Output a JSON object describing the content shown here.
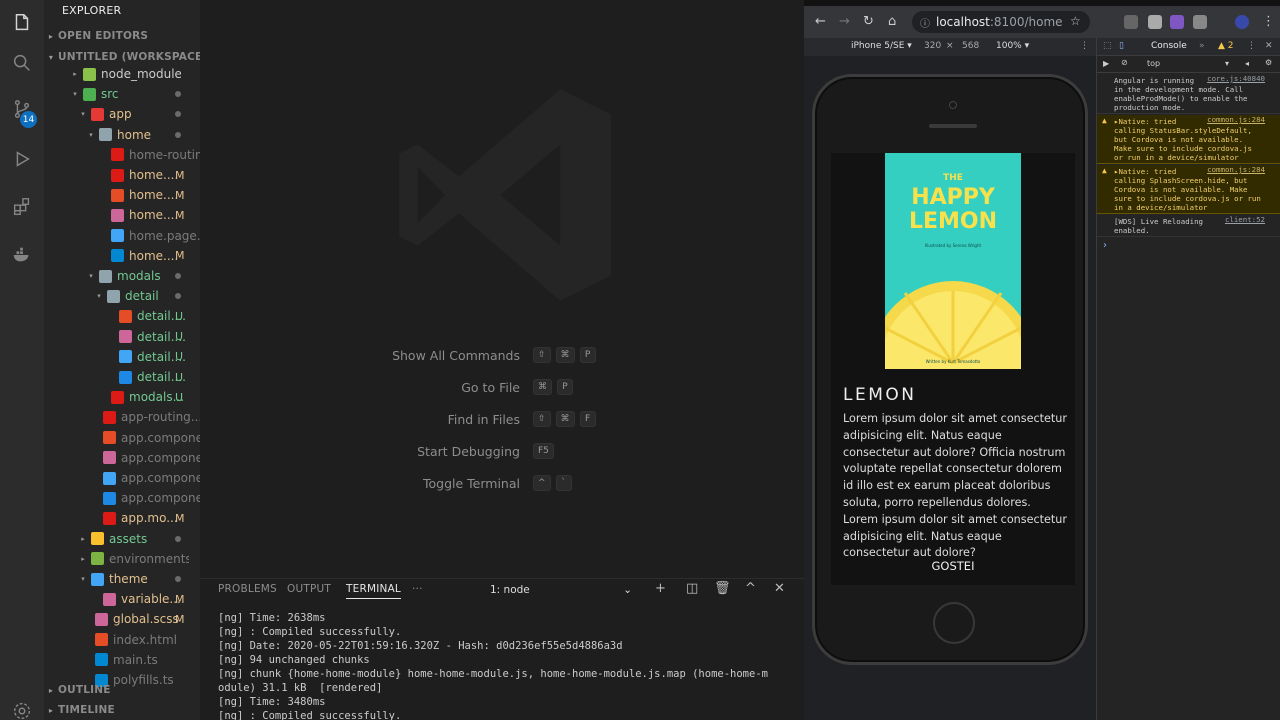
{
  "sidebar": {
    "title": "EXPLORER",
    "open_editors": "OPEN EDITORS",
    "workspace": "UNTITLED (WORKSPACE)",
    "outline": "OUTLINE",
    "timeline": "TIMELINE",
    "badge_count": "14",
    "items": [
      {
        "label": "node_modules",
        "status": "",
        "color": "#cccccc",
        "icon": "folder-node-icon",
        "icon_color": "#8bc34a"
      },
      {
        "label": "src",
        "status": "dot",
        "color": "#73c991",
        "icon": "folder-src-icon",
        "icon_color": "#4caf50"
      },
      {
        "label": "app",
        "status": "dot",
        "color": "#e2c08d",
        "icon": "folder-app-icon",
        "icon_color": "#e53935"
      },
      {
        "label": "home",
        "status": "dot",
        "color": "#e2c08d",
        "icon": "folder-icon",
        "icon_color": "#90a4ae"
      },
      {
        "label": "home-routin...",
        "status": "",
        "color": "#7b7b7b",
        "icon": "angular-icon",
        "icon_color": "#dd1b16"
      },
      {
        "label": "home....",
        "status": "M",
        "color": "#e2c08d",
        "icon": "angular-icon",
        "icon_color": "#dd1b16"
      },
      {
        "label": "home....",
        "status": "M",
        "color": "#e2c08d",
        "icon": "html-icon",
        "icon_color": "#e44d26"
      },
      {
        "label": "home....",
        "status": "M",
        "color": "#e2c08d",
        "icon": "sass-icon",
        "icon_color": "#cd6799"
      },
      {
        "label": "home.page....",
        "status": "",
        "color": "#7b7b7b",
        "icon": "test-flask-icon",
        "icon_color": "#42a5f5"
      },
      {
        "label": "home....",
        "status": "M",
        "color": "#e2c08d",
        "icon": "typescript-icon",
        "icon_color": "#0288d1"
      },
      {
        "label": "modals",
        "status": "dot",
        "color": "#73c991",
        "icon": "folder-icon",
        "icon_color": "#90a4ae"
      },
      {
        "label": "detail",
        "status": "dot",
        "color": "#73c991",
        "icon": "folder-icon",
        "icon_color": "#90a4ae"
      },
      {
        "label": "detail....",
        "status": "U",
        "color": "#73c991",
        "icon": "html-icon",
        "icon_color": "#e44d26"
      },
      {
        "label": "detail....",
        "status": "U",
        "color": "#73c991",
        "icon": "sass-icon",
        "icon_color": "#cd6799"
      },
      {
        "label": "detail....",
        "status": "U",
        "color": "#73c991",
        "icon": "test-flask-icon",
        "icon_color": "#42a5f5"
      },
      {
        "label": "detail....",
        "status": "U",
        "color": "#73c991",
        "icon": "angular-blue-icon",
        "icon_color": "#1e88e5"
      },
      {
        "label": "modals...",
        "status": "U",
        "color": "#73c991",
        "icon": "angular-icon",
        "icon_color": "#dd1b16"
      },
      {
        "label": "app-routing....",
        "status": "",
        "color": "#7b7b7b",
        "icon": "angular-icon",
        "icon_color": "#dd1b16"
      },
      {
        "label": "app.compone...",
        "status": "",
        "color": "#7b7b7b",
        "icon": "html-icon",
        "icon_color": "#e44d26"
      },
      {
        "label": "app.compone...",
        "status": "",
        "color": "#7b7b7b",
        "icon": "sass-icon",
        "icon_color": "#cd6799"
      },
      {
        "label": "app.compone...",
        "status": "",
        "color": "#7b7b7b",
        "icon": "test-flask-icon",
        "icon_color": "#42a5f5"
      },
      {
        "label": "app.compone...",
        "status": "",
        "color": "#7b7b7b",
        "icon": "angular-blue-icon",
        "icon_color": "#1e88e5"
      },
      {
        "label": "app.mo...",
        "status": "M",
        "color": "#e2c08d",
        "icon": "angular-icon",
        "icon_color": "#dd1b16"
      },
      {
        "label": "assets",
        "status": "dot",
        "color": "#73c991",
        "icon": "folder-assets-icon",
        "icon_color": "#fbc02d"
      },
      {
        "label": "environments",
        "status": "",
        "color": "#7b7b7b",
        "icon": "folder-env-icon",
        "icon_color": "#7cb342"
      },
      {
        "label": "theme",
        "status": "dot",
        "color": "#e2c08d",
        "icon": "folder-theme-icon",
        "icon_color": "#42a5f5"
      },
      {
        "label": "variable...",
        "status": "M",
        "color": "#e2c08d",
        "icon": "sass-icon",
        "icon_color": "#cd6799"
      },
      {
        "label": "global.scss",
        "status": "M",
        "color": "#e2c08d",
        "icon": "sass-icon",
        "icon_color": "#cd6799"
      },
      {
        "label": "index.html",
        "status": "",
        "color": "#7b7b7b",
        "icon": "html-icon",
        "icon_color": "#e44d26"
      },
      {
        "label": "main.ts",
        "status": "",
        "color": "#7b7b7b",
        "icon": "typescript-icon",
        "icon_color": "#0288d1"
      },
      {
        "label": "polyfills.ts",
        "status": "",
        "color": "#7b7b7b",
        "icon": "typescript-icon",
        "icon_color": "#0288d1"
      }
    ]
  },
  "welcome": {
    "commands": [
      {
        "label": "Show All Commands",
        "keys": [
          "⇧",
          "⌘",
          "P"
        ]
      },
      {
        "label": "Go to File",
        "keys": [
          "⌘",
          "P"
        ]
      },
      {
        "label": "Find in Files",
        "keys": [
          "⇧",
          "⌘",
          "F"
        ]
      },
      {
        "label": "Start Debugging",
        "keys": [
          "F5"
        ]
      },
      {
        "label": "Toggle Terminal",
        "keys": [
          "^",
          "`"
        ]
      }
    ]
  },
  "panel": {
    "tabs": [
      "PROBLEMS",
      "OUTPUT",
      "TERMINAL",
      "···"
    ],
    "terminal_select": "1: node",
    "lines": [
      "[ng] Time: 2638ms",
      "[ng] : Compiled successfully.",
      "[ng] Date: 2020-05-22T01:59:16.320Z - Hash: d0d236ef55e5d4886a3d",
      "[ng] 94 unchanged chunks",
      "[ng] chunk {home-home-module} home-home-module.js, home-home-module.js.map (home-home-m",
      "odule) 31.1 kB  [rendered]",
      "[ng] Time: 3480ms",
      "[ng] : Compiled successfully."
    ]
  },
  "browser": {
    "url_host": "localhost",
    "url_path": ":8100/home",
    "device": "iPhone 5/SE ▾",
    "width": "320",
    "height": "568",
    "zoom": "100% ▾"
  },
  "app": {
    "cover_the": "THE",
    "cover_happy": "HAPPY",
    "cover_lemon": "LEMON",
    "cover_illustrated": "Illustrated by Serena Wright",
    "cover_written": "Written by Kurt Tomasdotto",
    "title": "LEMON",
    "body": "Lorem ipsum dolor sit amet consectetur adipisicing elit. Natus eaque consectetur aut dolore? Officia nostrum voluptate repellat consectetur dolorem id illo est ex earum placeat doloribus soluta, porro repellendus dolores. Lorem ipsum dolor sit amet consectetur adipisicing elit. Natus eaque consectetur aut dolore?",
    "button": "GOSTEI"
  },
  "devtools": {
    "tab": "Console",
    "warnings": "▲ 2",
    "context": "top",
    "messages": [
      {
        "type": "info",
        "text": "Angular is running\nin the development mode. Call\nenableProdMode() to enable the\nproduction mode.",
        "src": "core.js:40840"
      },
      {
        "type": "warn",
        "text": "▸Native: tried\ncalling StatusBar.styleDefault,\nbut Cordova is not available.\nMake sure to include cordova.js\nor run in a device/simulator",
        "src": "common.js:284"
      },
      {
        "type": "warn",
        "text": "▸Native: tried\ncalling SplashScreen.hide, but\nCordova is not available. Make\nsure to include cordova.js or run\nin a device/simulator",
        "src": "common.js:284"
      },
      {
        "type": "info",
        "text": "[WDS] Live Reloading\nenabled.",
        "src": "client:52"
      }
    ],
    "prompt": "›"
  }
}
